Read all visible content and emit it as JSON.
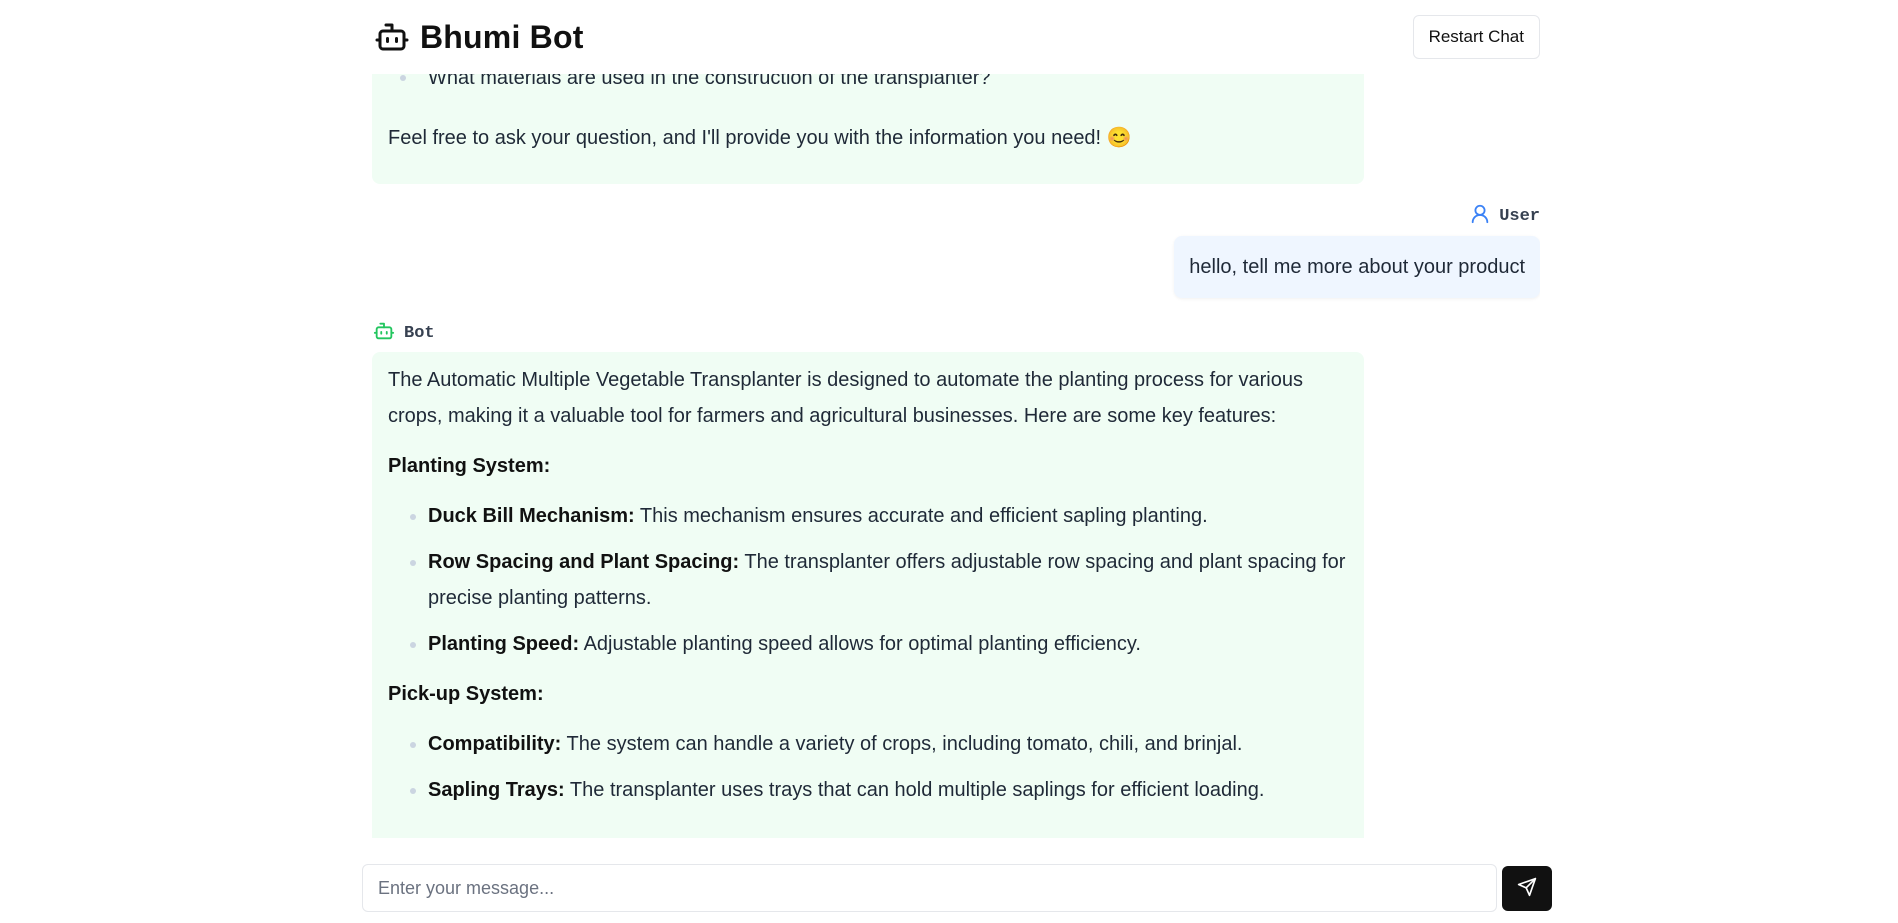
{
  "header": {
    "title": "Bhumi Bot",
    "restart_label": "Restart Chat"
  },
  "colors": {
    "bot_bubble": "#f0fdf4",
    "user_bubble": "#eff6ff",
    "bot_icon": "#22c55e",
    "user_icon": "#3b82f6",
    "send_button": "#111111"
  },
  "previous_message": {
    "list_item": "What materials are used in the construction of the transplanter?",
    "closing": "Feel free to ask your question, and I'll provide you with the information you need! 😊"
  },
  "user_message": {
    "role": "User",
    "text": "hello, tell me more about your product"
  },
  "bot_message": {
    "role": "Bot",
    "intro": "The Automatic Multiple Vegetable Transplanter is designed to automate the planting process for various crops, making it a valuable tool for farmers and agricultural businesses. Here are some key features:",
    "sections": [
      {
        "heading": "Planting System:",
        "items": [
          {
            "term": "Duck Bill Mechanism:",
            "text": "This mechanism ensures accurate and efficient sapling planting."
          },
          {
            "term": "Row Spacing and Plant Spacing:",
            "text": "The transplanter offers adjustable row spacing and plant spacing for precise planting patterns."
          },
          {
            "term": "Planting Speed:",
            "text": "Adjustable planting speed allows for optimal planting efficiency."
          }
        ]
      },
      {
        "heading": "Pick-up System:",
        "items": [
          {
            "term": "Compatibility:",
            "text": "The system can handle a variety of crops, including tomato, chili, and brinjal."
          },
          {
            "term": "Sapling Trays:",
            "text": "The transplanter uses trays that can hold multiple saplings for efficient loading."
          }
        ]
      }
    ]
  },
  "input": {
    "placeholder": "Enter your message..."
  },
  "icons": {
    "brand": "robot-icon",
    "user": "user-icon",
    "bot": "robot-icon",
    "send": "send-icon"
  }
}
